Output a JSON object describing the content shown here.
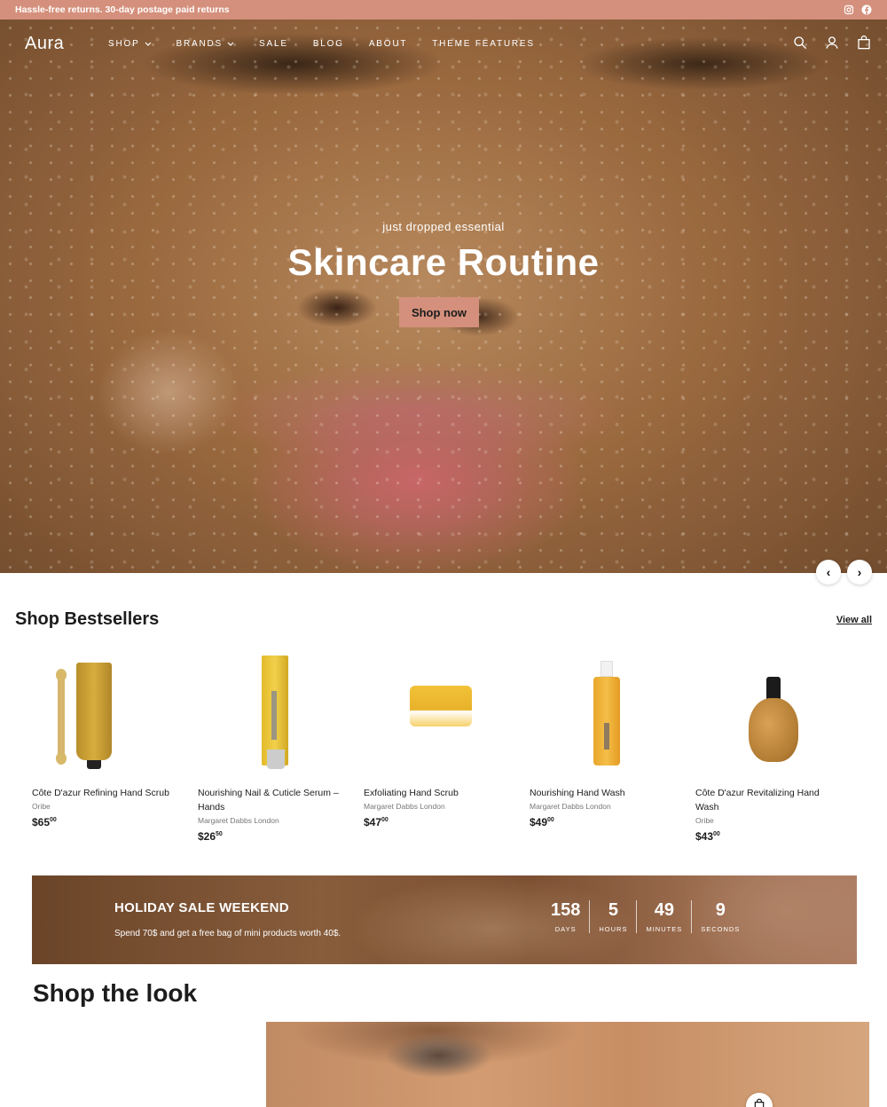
{
  "announcement": {
    "text": "Hassle-free returns. 30-day postage paid returns",
    "social_icons": [
      "instagram-icon",
      "facebook-icon"
    ]
  },
  "nav": {
    "logo": "Aura",
    "items": [
      {
        "label": "SHOP",
        "dropdown": true
      },
      {
        "label": "BRANDS",
        "dropdown": true
      },
      {
        "label": "SALE",
        "dropdown": false
      },
      {
        "label": "BLOG",
        "dropdown": false
      },
      {
        "label": "ABOUT",
        "dropdown": false
      },
      {
        "label": "THEME FEATURES",
        "dropdown": false
      }
    ],
    "icons": [
      "search-icon",
      "account-icon",
      "cart-icon"
    ]
  },
  "hero": {
    "subtitle": "just dropped essential",
    "title": "Skincare Routine",
    "button": "Shop now",
    "prev": "‹",
    "next": "›"
  },
  "bestsellers": {
    "title": "Shop Bestsellers",
    "view_all": "View all",
    "products": [
      {
        "name": "Côte D'azur Refining Hand Scrub",
        "brand": "Oribe",
        "price_main": "$65",
        "price_cents": "00"
      },
      {
        "name": "Nourishing Nail & Cuticle Serum – Hands",
        "brand": "Margaret Dabbs London",
        "price_main": "$26",
        "price_cents": "50"
      },
      {
        "name": "Exfoliating Hand Scrub",
        "brand": "Margaret Dabbs London",
        "price_main": "$47",
        "price_cents": "00"
      },
      {
        "name": "Nourishing Hand Wash",
        "brand": "Margaret Dabbs London",
        "price_main": "$49",
        "price_cents": "00"
      },
      {
        "name": "Côte D'azur Revitalizing Hand Wash",
        "brand": "Oribe",
        "price_main": "$43",
        "price_cents": "00"
      }
    ]
  },
  "holiday": {
    "title": "HOLIDAY SALE WEEKEND",
    "text": "Spend 70$ and get a free bag of mini products worth 40$.",
    "countdown": [
      {
        "value": "158",
        "label": "DAYS"
      },
      {
        "value": "5",
        "label": "HOURS"
      },
      {
        "value": "49",
        "label": "MINUTES"
      },
      {
        "value": "9",
        "label": "SECONDS"
      }
    ]
  },
  "look": {
    "title": "Shop the look"
  },
  "colors": {
    "accent": "#d4907c",
    "text": "#1c1c1c"
  }
}
